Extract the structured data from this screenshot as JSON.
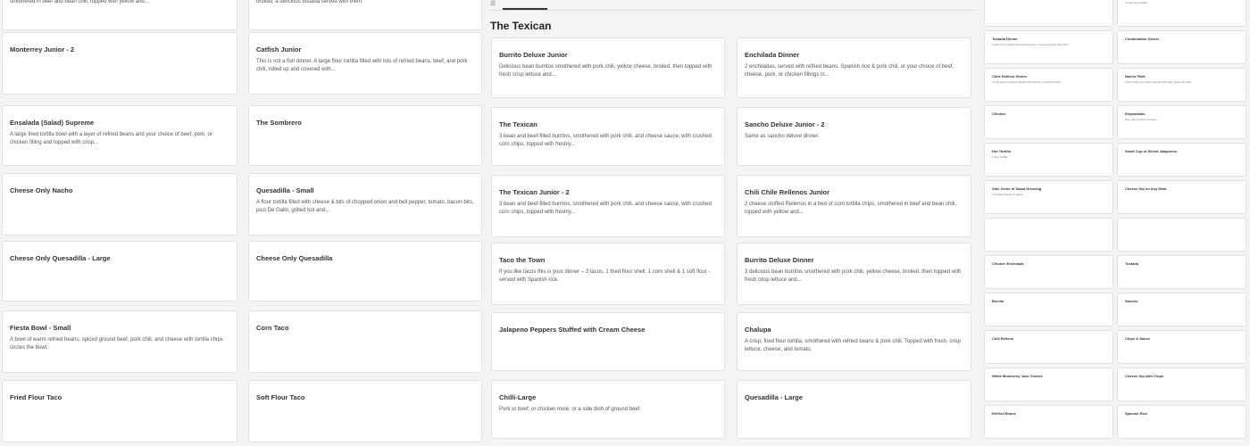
{
  "tab": {
    "label": "The Texican"
  },
  "section_title": "The Texican",
  "col1": [
    {
      "title": "",
      "desc": "smothered in beef and bean chili, topped with yellow and..."
    },
    {
      "title": "Monterrey Junior - 2",
      "desc": ""
    },
    {
      "title": "Ensalada (Salad) Supreme",
      "desc": "A large fried tortilla bowl with a layer of refried beans and your choice of beef, pork, or chicken filling and topped with crisp..."
    },
    {
      "title": "Cheese Only Nacho",
      "desc": ""
    },
    {
      "title": "Cheese Only Quesadilla - Large",
      "desc": ""
    },
    {
      "title": "Fiesta Bowl - Small",
      "desc": "A bowl of warm refried beans, spiced ground beef, pork chili, and cheese with tortilla chips circles the bowl."
    },
    {
      "title": "Fried Flour Taco",
      "desc": ""
    }
  ],
  "col2": [
    {
      "title": "",
      "desc": "broiled, a delicious tostada served with them."
    },
    {
      "title": "Catfish Junior",
      "desc": "This is not a fish dinner. A large flour tortilla filled with lots of refried beans, beef, and pork chili, rolled up and covered with..."
    },
    {
      "title": "The Sombrero",
      "desc": ""
    },
    {
      "title": "Quesadilla - Small",
      "desc": "A flour tortilla filled with cheese & bits of chopped onion and bell pepper, tomato, bacon-bits, pico De Gallo, grilled hot and..."
    },
    {
      "title": "Cheese Only Quesadilla",
      "desc": ""
    },
    {
      "title": "Corn Taco",
      "desc": ""
    },
    {
      "title": "Soft Flour Taco",
      "desc": ""
    }
  ],
  "col3": [
    {
      "title": "Burrito Deluxe Junior",
      "desc": "Delicious bean burritos smothered with pork chili, yellow cheese, broiled, then topped with fresh crisp lettuce and..."
    },
    {
      "title": "The Texican",
      "desc": "3 bean and beef-filled burritos, smothered with pork chili, and cheese sauce, with crushed corn chips, topped with freshly..."
    },
    {
      "title": "The Texican Junior - 2",
      "desc": "3 bean and beef-filled burritos, smothered with pork chili, and cheese sauce, with crushed corn chips, topped with freshly..."
    },
    {
      "title": "Taco the Town",
      "desc": "If you like tacos this is your dinner – 3 tacos, 1 fried flour shell, 1 corn shell & 1 soft flour - served with Spanish rice."
    },
    {
      "title": "Jalapeno Peppers Stuffed with Cream Cheese",
      "desc": ""
    },
    {
      "title": "Chilli-Large",
      "desc": "Pork or beef; or chicken mole; or a side dish of ground beef."
    }
  ],
  "col4": [
    {
      "title": "Enchilada Dinner",
      "desc": "2 enchiladas, served with refried beans, Spanish rice & pork chili, or your choice of beef, cheese, pork, or chicken fillings in..."
    },
    {
      "title": "Sancho Deluxe Junior - 2",
      "desc": "Same as sancho deluxe dinner."
    },
    {
      "title": "Chili Chile Rellenos Junior",
      "desc": "2 cheese stuffed Rellenos in a bed of corn tortilla chips, smothered in beef and bean chili, topped with yellow and..."
    },
    {
      "title": "Burrito Deluxe Dinner",
      "desc": "3 delicious bean burritos smothered with pork chili, yellow cheese, broiled, then topped with fresh crisp lettuce and..."
    },
    {
      "title": "Chalupa",
      "desc": "A crisp, fried flour tortilla, smothered with refried beans & pork chili. Topped with fresh, crisp lettuce, cheese, and tomato."
    },
    {
      "title": "Quesadilla - Large",
      "desc": ""
    }
  ],
  "col5": [
    {
      "title": "",
      "desc": ""
    },
    {
      "title": "Tostada Dinner",
      "desc": "2 fried corn tortillas with refried beans, smothered with pork chili..."
    },
    {
      "title": "Chile Relleno Dinner",
      "desc": "2 long green peppers stuffed with cheese, smothered with..."
    },
    {
      "title": "Chicken",
      "desc": ""
    },
    {
      "title": "Hot Tortilla",
      "desc": "1 flour tortilla"
    },
    {
      "title": "Side Order of Salad Dressing",
      "desc": "Thousand Island or Ranch"
    },
    {
      "title": "",
      "desc": ""
    },
    {
      "title": "Chicken Enchilada",
      "desc": ""
    },
    {
      "title": "Burrito",
      "desc": ""
    },
    {
      "title": "Chili Relleno",
      "desc": ""
    },
    {
      "title": "White Monterrey Jack Cheese",
      "desc": ""
    },
    {
      "title": "Refried Beans",
      "desc": ""
    }
  ],
  "col6": [
    {
      "title": "",
      "desc": "A crisp flour tortilla..."
    },
    {
      "title": "Combination Dinner",
      "desc": ""
    },
    {
      "title": "Nacho Plate",
      "desc": "Fresh crisp corn chips, topped with beef, bean and pork..."
    },
    {
      "title": "Empanadas",
      "desc": "Two pies of cream cheese..."
    },
    {
      "title": "Small Cup of Sliced Jalapenos",
      "desc": ""
    },
    {
      "title": "Cheese Dip on Any Meal",
      "desc": ""
    },
    {
      "title": "",
      "desc": ""
    },
    {
      "title": "Tostada",
      "desc": ""
    },
    {
      "title": "Sancho",
      "desc": ""
    },
    {
      "title": "Chips & Sauce",
      "desc": ""
    },
    {
      "title": "Cheese Dip with Chips",
      "desc": ""
    },
    {
      "title": "Spanish Rice",
      "desc": ""
    }
  ]
}
